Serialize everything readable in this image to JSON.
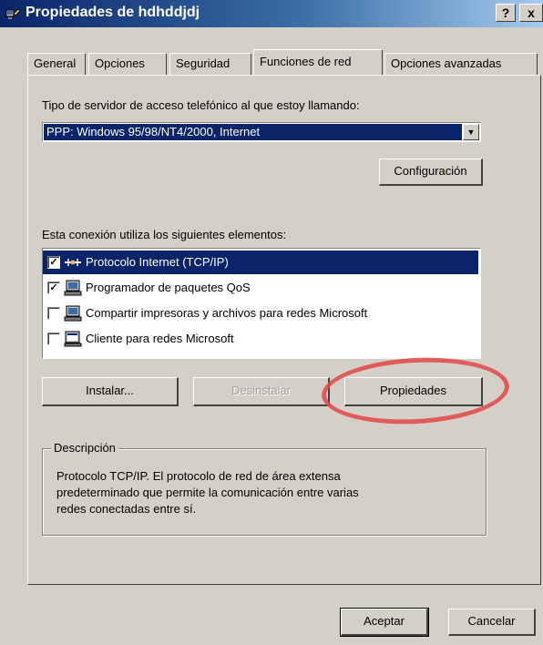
{
  "window": {
    "title": "Propiedades de hdhddjdj",
    "help_label": "?",
    "close_label": "x"
  },
  "tabs": [
    {
      "label": "General",
      "active": false
    },
    {
      "label": "Opciones",
      "active": false
    },
    {
      "label": "Seguridad",
      "active": false
    },
    {
      "label": "Funciones de red",
      "active": true
    },
    {
      "label": "Opciones avanzadas",
      "active": false
    }
  ],
  "server": {
    "label": "Tipo de servidor de acceso telefónico al que estoy llamando:",
    "selected": "PPP: Windows 95/98/NT4/2000, Internet",
    "config_button": "Configuración"
  },
  "components": {
    "label": "Esta conexión utiliza los siguientes elementos:",
    "items": [
      {
        "label": "Protocolo Internet (TCP/IP)",
        "checked": true,
        "selected": true,
        "icon": "network-protocol-icon"
      },
      {
        "label": "Programador de paquetes QoS",
        "checked": true,
        "selected": false,
        "icon": "network-service-icon"
      },
      {
        "label": "Compartir impresoras y archivos para redes Microsoft",
        "checked": false,
        "selected": false,
        "icon": "network-service-icon"
      },
      {
        "label": "Cliente para redes Microsoft",
        "checked": false,
        "selected": false,
        "icon": "network-client-icon"
      }
    ],
    "install_button": "Instalar...",
    "uninstall_button": "Desinstalar",
    "properties_button": "Propiedades"
  },
  "description": {
    "title": "Descripción",
    "text": "Protocolo TCP/IP. El protocolo de red de área extensa\npredeterminado que permite la comunicación entre varias\nredes conectadas entre sí."
  },
  "footer": {
    "ok_button": "Aceptar",
    "cancel_button": "Cancelar"
  },
  "colors": {
    "highlight": "#0a246a",
    "annotation_circle": "#e04848"
  }
}
